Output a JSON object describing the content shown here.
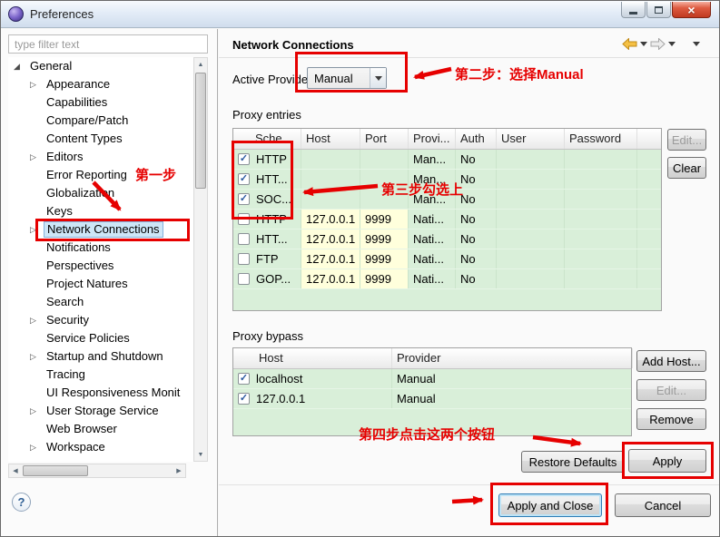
{
  "window": {
    "title": "Preferences"
  },
  "icons": {
    "close": "×",
    "check": "✓",
    "tree_expanded": "◢",
    "tree_collapsed": "▷",
    "up": "▲",
    "down": "▼",
    "left": "◀",
    "right": "▶"
  },
  "sidebar": {
    "filter_placeholder": "type filter text",
    "items": [
      {
        "label": "General",
        "level": 0,
        "arrow": "expanded",
        "selected": false
      },
      {
        "label": "Appearance",
        "level": 1,
        "arrow": "collapsed",
        "selected": false
      },
      {
        "label": "Capabilities",
        "level": 1,
        "arrow": "none",
        "selected": false
      },
      {
        "label": "Compare/Patch",
        "level": 1,
        "arrow": "none",
        "selected": false
      },
      {
        "label": "Content Types",
        "level": 1,
        "arrow": "none",
        "selected": false
      },
      {
        "label": "Editors",
        "level": 1,
        "arrow": "collapsed",
        "selected": false
      },
      {
        "label": "Error Reporting",
        "level": 1,
        "arrow": "none",
        "selected": false
      },
      {
        "label": "Globalization",
        "level": 1,
        "arrow": "none",
        "selected": false
      },
      {
        "label": "Keys",
        "level": 1,
        "arrow": "none",
        "selected": false
      },
      {
        "label": "Network Connections",
        "level": 1,
        "arrow": "collapsed",
        "selected": true
      },
      {
        "label": "Notifications",
        "level": 1,
        "arrow": "none",
        "selected": false
      },
      {
        "label": "Perspectives",
        "level": 1,
        "arrow": "none",
        "selected": false
      },
      {
        "label": "Project Natures",
        "level": 1,
        "arrow": "none",
        "selected": false
      },
      {
        "label": "Search",
        "level": 1,
        "arrow": "none",
        "selected": false
      },
      {
        "label": "Security",
        "level": 1,
        "arrow": "collapsed",
        "selected": false
      },
      {
        "label": "Service Policies",
        "level": 1,
        "arrow": "none",
        "selected": false
      },
      {
        "label": "Startup and Shutdown",
        "level": 1,
        "arrow": "collapsed",
        "selected": false
      },
      {
        "label": "Tracing",
        "level": 1,
        "arrow": "none",
        "selected": false
      },
      {
        "label": "UI Responsiveness Monit",
        "level": 1,
        "arrow": "none",
        "selected": false
      },
      {
        "label": "User Storage Service",
        "level": 1,
        "arrow": "collapsed",
        "selected": false
      },
      {
        "label": "Web Browser",
        "level": 1,
        "arrow": "none",
        "selected": false
      },
      {
        "label": "Workspace",
        "level": 1,
        "arrow": "collapsed",
        "selected": false
      }
    ]
  },
  "content": {
    "title": "Network Connections",
    "active_provider": {
      "label": "Active Provider:",
      "value": "Manual"
    },
    "proxy_entries": {
      "title": "Proxy entries",
      "columns": [
        "Sche...",
        "Host",
        "Port",
        "Provi...",
        "Auth",
        "User",
        "Password"
      ],
      "rows": [
        {
          "checked": true,
          "schema": "HTTP",
          "host": "",
          "port": "",
          "provider": "Man...",
          "auth": "No",
          "user": "",
          "password": ""
        },
        {
          "checked": true,
          "schema": "HTT...",
          "host": "",
          "port": "",
          "provider": "Man...",
          "auth": "No",
          "user": "",
          "password": ""
        },
        {
          "checked": true,
          "schema": "SOC...",
          "host": "",
          "port": "",
          "provider": "Man...",
          "auth": "No",
          "user": "",
          "password": ""
        },
        {
          "checked": false,
          "schema": "HTTP",
          "host": "127.0.0.1",
          "port": "9999",
          "provider": "Nati...",
          "auth": "No",
          "user": "",
          "password": ""
        },
        {
          "checked": false,
          "schema": "HTT...",
          "host": "127.0.0.1",
          "port": "9999",
          "provider": "Nati...",
          "auth": "No",
          "user": "",
          "password": ""
        },
        {
          "checked": false,
          "schema": "FTP",
          "host": "127.0.0.1",
          "port": "9999",
          "provider": "Nati...",
          "auth": "No",
          "user": "",
          "password": ""
        },
        {
          "checked": false,
          "schema": "GOP...",
          "host": "127.0.0.1",
          "port": "9999",
          "provider": "Nati...",
          "auth": "No",
          "user": "",
          "password": ""
        }
      ],
      "buttons": {
        "edit": "Edit...",
        "clear": "Clear"
      }
    },
    "proxy_bypass": {
      "title": "Proxy bypass",
      "columns": [
        "Host",
        "Provider"
      ],
      "rows": [
        {
          "checked": true,
          "host": "localhost",
          "provider": "Manual"
        },
        {
          "checked": true,
          "host": "127.0.0.1",
          "provider": "Manual"
        }
      ],
      "buttons": {
        "add": "Add Host...",
        "edit": "Edit...",
        "remove": "Remove"
      }
    },
    "buttons": {
      "restore": "Restore Defaults",
      "apply": "Apply",
      "apply_close": "Apply and Close",
      "cancel": "Cancel"
    },
    "help": "?"
  },
  "annotations": {
    "color": "#e60000",
    "step1": "第一步",
    "step2": "第二步：选择Manual",
    "step3": "第三步勾选上",
    "step4": "第四步点击这两个按钮"
  }
}
